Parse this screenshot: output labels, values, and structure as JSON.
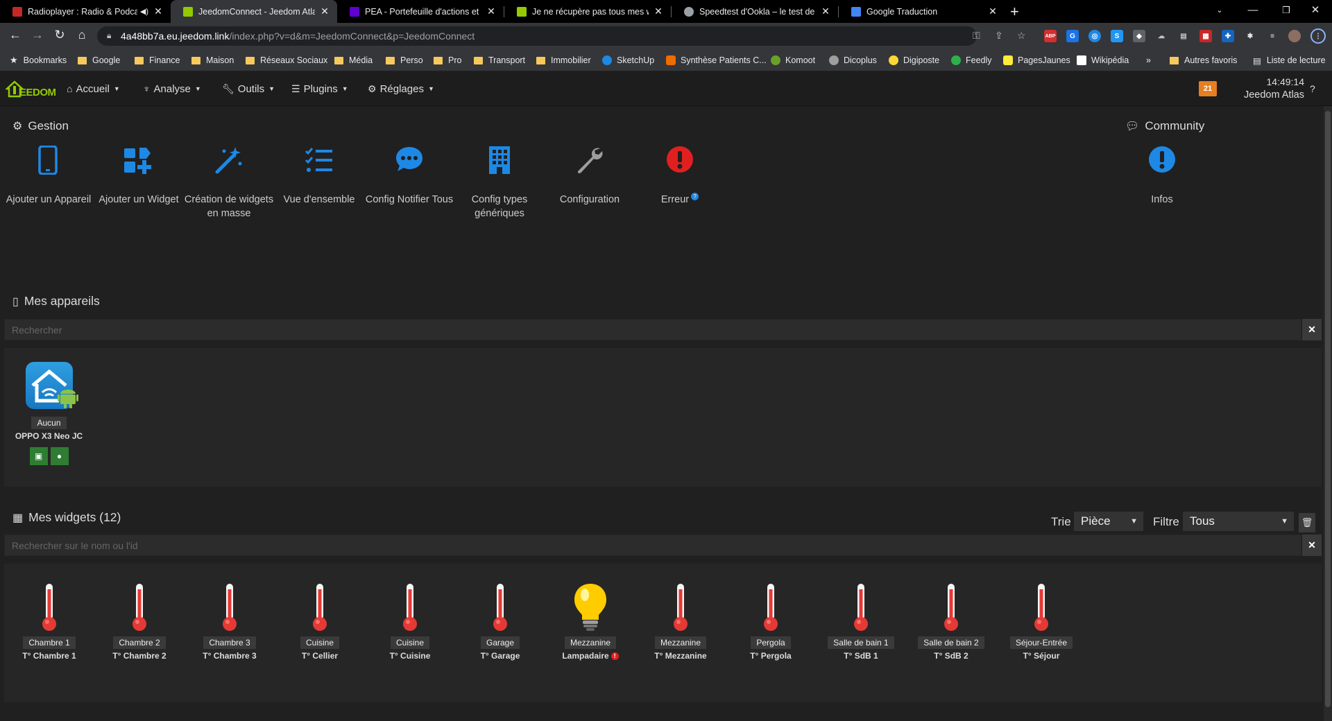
{
  "browser": {
    "tabs": [
      {
        "title": "Radioplayer : Radio & Podcas",
        "active": false,
        "audio": true
      },
      {
        "title": "JeedomConnect - Jeedom Atlas",
        "active": true
      },
      {
        "title": "PEA - Portefeuille d'actions et sy",
        "active": false
      },
      {
        "title": "Je ne récupère pas tous mes widg",
        "active": false
      },
      {
        "title": "Speedtest d'Ookla – le test de vit",
        "active": false
      },
      {
        "title": "Google Traduction",
        "active": false
      }
    ],
    "url_host": "4a48bb7a.eu.jeedom.link",
    "url_path": "/index.php?v=d&m=JeedomConnect&p=JeedomConnect",
    "bookmarks": [
      {
        "label": "Bookmarks",
        "icon": "star-icon"
      },
      {
        "label": "Google",
        "icon": "folder-icon"
      },
      {
        "label": "Finance",
        "icon": "folder-icon"
      },
      {
        "label": "Maison",
        "icon": "folder-icon"
      },
      {
        "label": "Réseaux Sociaux",
        "icon": "folder-icon"
      },
      {
        "label": "Média",
        "icon": "folder-icon"
      },
      {
        "label": "Perso",
        "icon": "folder-icon"
      },
      {
        "label": "Pro",
        "icon": "folder-icon"
      },
      {
        "label": "Transport",
        "icon": "folder-icon"
      },
      {
        "label": "Immobilier",
        "icon": "folder-icon"
      },
      {
        "label": "SketchUp",
        "icon": "sketchup-icon"
      },
      {
        "label": "Synthèse Patients C...",
        "icon": "site-icon"
      },
      {
        "label": "Komoot",
        "icon": "komoot-icon"
      },
      {
        "label": "Dicoplus",
        "icon": "site-icon"
      },
      {
        "label": "Digiposte",
        "icon": "site-icon"
      },
      {
        "label": "Feedly",
        "icon": "feedly-icon"
      },
      {
        "label": "PagesJaunes",
        "icon": "site-icon"
      },
      {
        "label": "Wikipédia",
        "icon": "wikipedia-icon"
      },
      {
        "label": "»",
        "icon": ""
      },
      {
        "label": "Autres favoris",
        "icon": "folder-icon"
      },
      {
        "label": "Liste de lecture",
        "icon": "reading-list-icon"
      }
    ]
  },
  "jeedom": {
    "logo_text": "EEDOM",
    "menu": [
      {
        "label": "Accueil",
        "icon": "home-icon"
      },
      {
        "label": "Analyse",
        "icon": "stethoscope-icon"
      },
      {
        "label": "Outils",
        "icon": "wrench-icon"
      },
      {
        "label": "Plugins",
        "icon": "list-icon"
      },
      {
        "label": "Réglages",
        "icon": "cogs-icon"
      }
    ],
    "notif_count": "21",
    "time": "14:49:14",
    "instance": "Jeedom Atlas"
  },
  "gestion": {
    "title": "Gestion",
    "items": [
      {
        "label": "Ajouter un Appareil",
        "icon": "mobile-icon"
      },
      {
        "label": "Ajouter un Widget",
        "icon": "add-widget-icon"
      },
      {
        "label": "Création de widgets en masse",
        "icon": "magic-wand-icon"
      },
      {
        "label": "Vue d'ensemble",
        "icon": "checklist-icon"
      },
      {
        "label": "Config Notifier Tous",
        "icon": "comment-dots-icon"
      },
      {
        "label": "Config types génériques",
        "icon": "building-icon"
      },
      {
        "label": "Configuration",
        "icon": "wrench-icon"
      },
      {
        "label": "Erreur",
        "icon": "error-icon"
      }
    ]
  },
  "community": {
    "title": "Community",
    "items": [
      {
        "label": "Infos",
        "icon": "info-icon"
      }
    ]
  },
  "devices": {
    "title": "Mes appareils",
    "search_placeholder": "Rechercher",
    "items": [
      {
        "room": "Aucun",
        "name": "OPPO X3 Neo JC"
      }
    ]
  },
  "widgets": {
    "title": "Mes widgets (12)",
    "sort_label": "Trie",
    "sort_value": "Pièce",
    "filter_label": "Filtre",
    "filter_value": "Tous",
    "search_placeholder": "Rechercher sur le nom ou l'id",
    "items": [
      {
        "room": "Chambre 1",
        "name": "T° Chambre 1",
        "icon": "thermometer-icon"
      },
      {
        "room": "Chambre 2",
        "name": "T° Chambre 2",
        "icon": "thermometer-icon"
      },
      {
        "room": "Chambre 3",
        "name": "T° Chambre 3",
        "icon": "thermometer-icon"
      },
      {
        "room": "Cuisine",
        "name": "T° Cellier",
        "icon": "thermometer-icon"
      },
      {
        "room": "Cuisine",
        "name": "T° Cuisine",
        "icon": "thermometer-icon"
      },
      {
        "room": "Garage",
        "name": "T° Garage",
        "icon": "thermometer-icon"
      },
      {
        "room": "Mezzanine",
        "name": "Lampadaire",
        "icon": "lightbulb-icon",
        "error": true
      },
      {
        "room": "Mezzanine",
        "name": "T° Mezzanine",
        "icon": "thermometer-icon"
      },
      {
        "room": "Pergola",
        "name": "T° Pergola",
        "icon": "thermometer-icon"
      },
      {
        "room": "Salle de bain 1",
        "name": "T° SdB 1",
        "icon": "thermometer-icon"
      },
      {
        "room": "Salle de bain 2",
        "name": "T° SdB 2",
        "icon": "thermometer-icon"
      },
      {
        "room": "Séjour-Entrée",
        "name": "T° Séjour",
        "icon": "thermometer-icon"
      }
    ]
  },
  "colors": {
    "accent_blue": "#1e88e5",
    "error_red": "#e02020",
    "jeedom_green": "#94ca02",
    "badge_orange": "#e67e22"
  }
}
